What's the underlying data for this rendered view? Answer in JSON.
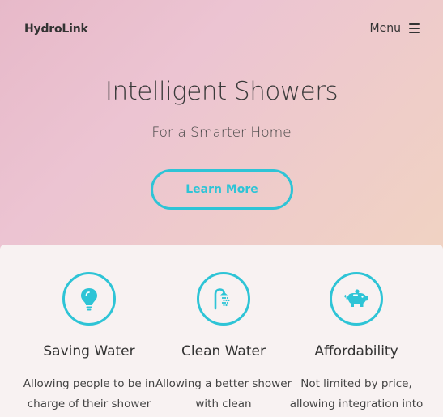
{
  "navbar": {
    "brand": "HydroLink",
    "menu_label": "Menu",
    "menu_icon": "hamburger-icon"
  },
  "hero": {
    "title": "Intelligent Showers",
    "subtitle": "For a Smarter Home",
    "cta_label": "Learn More"
  },
  "colors": {
    "accent": "#2ec4d6",
    "hero_gradient_start": "#e7b9c9",
    "hero_gradient_end": "#f0d3c2"
  },
  "features": [
    {
      "icon": "lightbulb-icon",
      "title": "Saving Water",
      "text": "Allowing people to be in charge of their shower"
    },
    {
      "icon": "shower-icon",
      "title": "Clean Water",
      "text": "Allowing a better shower with clean"
    },
    {
      "icon": "piggy-bank-icon",
      "title": "Affordability",
      "text": "Not limited by price, allowing integration into"
    }
  ]
}
